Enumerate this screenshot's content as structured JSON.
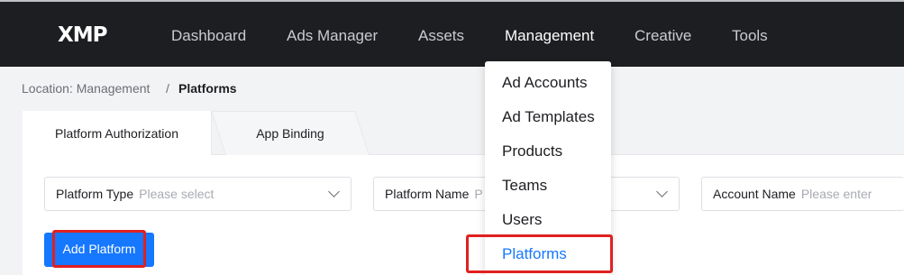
{
  "logo": "XMP",
  "nav": [
    {
      "label": "Dashboard",
      "active": false
    },
    {
      "label": "Ads Manager",
      "active": false
    },
    {
      "label": "Assets",
      "active": false
    },
    {
      "label": "Management",
      "active": true
    },
    {
      "label": "Creative",
      "active": false
    },
    {
      "label": "Tools",
      "active": false
    }
  ],
  "breadcrumb": {
    "location": "Location: Management",
    "separator": "/",
    "current": "Platforms"
  },
  "tabs": [
    {
      "label": "Platform Authorization",
      "active": true
    },
    {
      "label": "App Binding",
      "active": false
    }
  ],
  "filters": {
    "platform_type": {
      "label": "Platform Type",
      "placeholder": "Please select"
    },
    "platform_name": {
      "label": "Platform Name",
      "placeholder": "P"
    },
    "account_name": {
      "label": "Account Name",
      "placeholder": "Please enter"
    }
  },
  "add_button": {
    "label": "Add Platform"
  },
  "management_menu": [
    {
      "label": "Ad Accounts"
    },
    {
      "label": "Ad Templates"
    },
    {
      "label": "Products"
    },
    {
      "label": "Teams"
    },
    {
      "label": "Users"
    },
    {
      "label": "Platforms",
      "selected": true
    }
  ],
  "colors": {
    "topbar": "#1d1e22",
    "accent": "#1677ff",
    "highlight": "#e02020"
  }
}
